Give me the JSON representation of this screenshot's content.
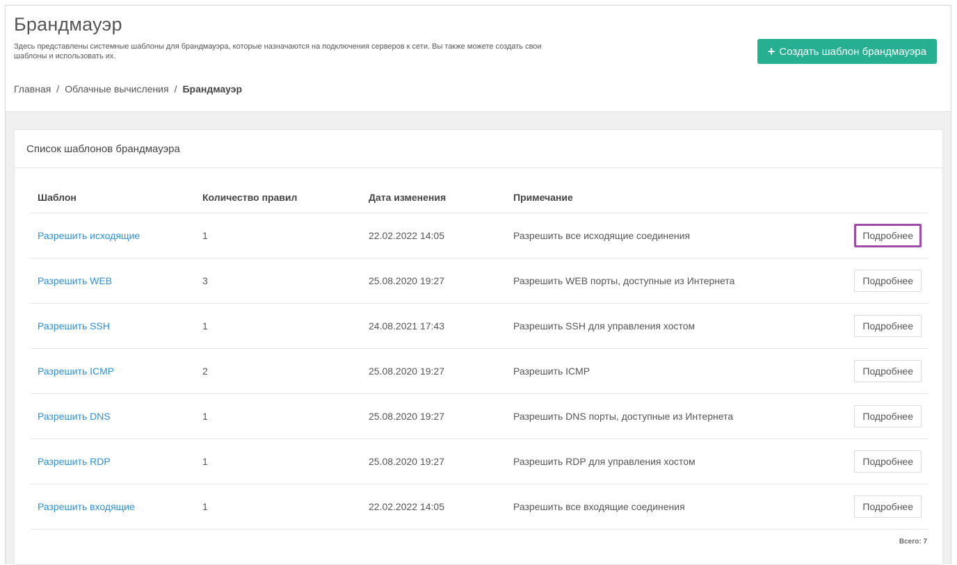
{
  "header": {
    "title": "Брандмауэр",
    "description": "Здесь представлены системные шаблоны для брандмауэра, которые назначаются на подключения серверов к сети. Вы также можете создать свои шаблоны и использовать их.",
    "create_button_label": "Создать шаблон брандмауэра",
    "create_button_icon": "plus-icon"
  },
  "breadcrumb": {
    "items": [
      "Главная",
      "Облачные вычисления",
      "Брандмауэр"
    ],
    "separator": "/"
  },
  "panel": {
    "title": "Список шаблонов брандмауэра",
    "columns": [
      "Шаблон",
      "Количество правил",
      "Дата изменения",
      "Примечание"
    ],
    "rows": [
      {
        "name": "Разрешить исходящие",
        "count": "1",
        "date": "22.02.2022 14:05",
        "note": "Разрешить все исходящие соединения",
        "action": "Подробнее"
      },
      {
        "name": "Разрешить WEB",
        "count": "3",
        "date": "25.08.2020 19:27",
        "note": "Разрешить WEB порты, доступные из Интернета",
        "action": "Подробнее"
      },
      {
        "name": "Разрешить SSH",
        "count": "1",
        "date": "24.08.2021 17:43",
        "note": "Разрешить SSH для управления хостом",
        "action": "Подробнее"
      },
      {
        "name": "Разрешить ICMP",
        "count": "2",
        "date": "25.08.2020 19:27",
        "note": "Разрешить ICMP",
        "action": "Подробнее"
      },
      {
        "name": "Разрешить DNS",
        "count": "1",
        "date": "25.08.2020 19:27",
        "note": "Разрешить DNS порты, доступные из Интернета",
        "action": "Подробнее"
      },
      {
        "name": "Разрешить RDP",
        "count": "1",
        "date": "25.08.2020 19:27",
        "note": "Разрешить RDP для управления хостом",
        "action": "Подробнее"
      },
      {
        "name": "Разрешить входящие",
        "count": "1",
        "date": "22.02.2022 14:05",
        "note": "Разрешить все входящие соединения",
        "action": "Подробнее"
      }
    ],
    "total_label": "Всего: 7"
  },
  "colors": {
    "accent": "#26b091",
    "link": "#2b8fd6",
    "highlight_border": "#a04aa8"
  }
}
